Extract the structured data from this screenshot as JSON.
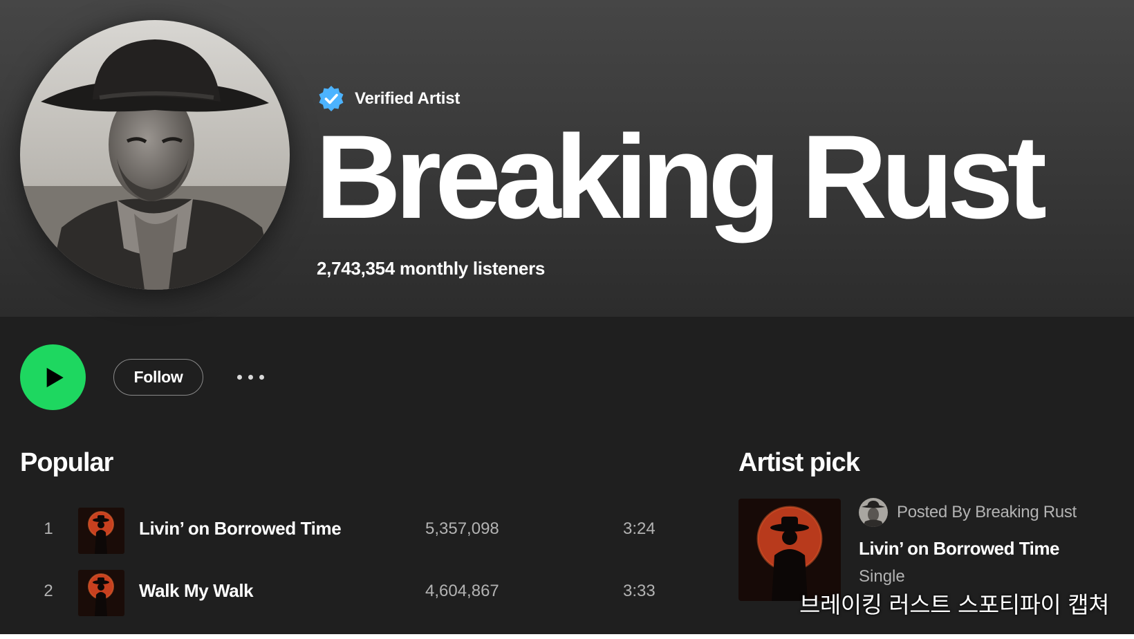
{
  "header": {
    "verified_label": "Verified Artist",
    "artist_name": "Breaking Rust",
    "monthly_listeners": "2,743,354 monthly listeners"
  },
  "actions": {
    "follow_label": "Follow"
  },
  "popular": {
    "title": "Popular",
    "tracks": [
      {
        "rank": "1",
        "title": "Livin’ on Borrowed Time",
        "plays": "5,357,098",
        "duration": "3:24"
      },
      {
        "rank": "2",
        "title": "Walk My Walk",
        "plays": "4,604,867",
        "duration": "3:33"
      }
    ]
  },
  "artist_pick": {
    "title": "Artist pick",
    "posted_by": "Posted By Breaking Rust",
    "track_title": "Livin’ on Borrowed Time",
    "type": "Single"
  },
  "caption": "브레이킹 러스트 스포티파이 캡쳐",
  "colors": {
    "accent_green": "#1ed760",
    "verified_blue": "#4cb3ff",
    "background": "#1f1f1f",
    "muted_text": "#b3b3b3"
  },
  "icons": {
    "verified": "verified-badge-icon",
    "play": "play-icon",
    "more": "more-options-icon"
  }
}
